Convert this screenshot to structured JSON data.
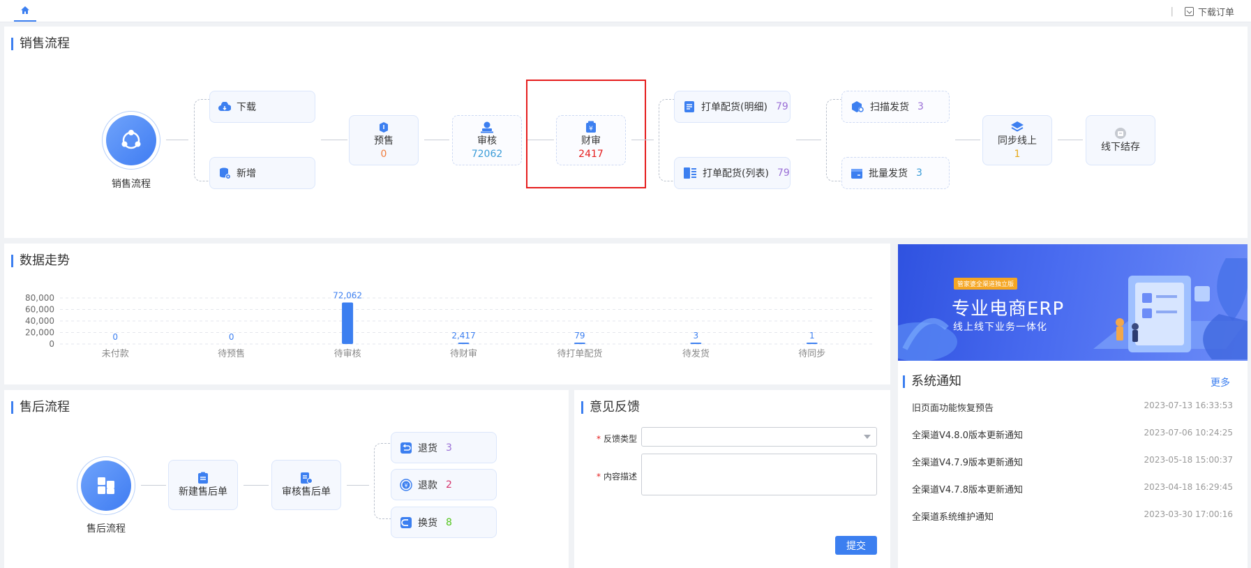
{
  "topbar": {
    "download_label": "下载订单",
    "sep": "|"
  },
  "sales": {
    "title": "销售流程",
    "start_label": "销售流程",
    "download": "下载",
    "add": "新增",
    "presale": {
      "label": "预售",
      "count": "0"
    },
    "audit": {
      "label": "审核",
      "count": "72062"
    },
    "finance": {
      "label": "财审",
      "count": "2417"
    },
    "print_detail": {
      "label": "打单配货(明细)",
      "count": "79"
    },
    "print_list": {
      "label": "打单配货(列表)",
      "count": "79"
    },
    "scan_ship": {
      "label": "扫描发货",
      "count": "3"
    },
    "batch_ship": {
      "label": "批量发货",
      "count": "3"
    },
    "sync": {
      "label": "同步线上",
      "count": "1"
    },
    "offline": {
      "label": "线下结存"
    }
  },
  "trend": {
    "title": "数据走势"
  },
  "chart_data": {
    "type": "bar",
    "categories": [
      "未付款",
      "待预售",
      "待审核",
      "待财审",
      "待打单配货",
      "待发货",
      "待同步"
    ],
    "values": [
      0,
      0,
      72062,
      2417,
      79,
      3,
      1
    ],
    "value_labels": [
      "0",
      "0",
      "72,062",
      "2,417",
      "79",
      "3",
      "1"
    ],
    "yticks": [
      "80,000",
      "60,000",
      "40,000",
      "20,000",
      "0"
    ],
    "ylim": [
      0,
      80000
    ],
    "grid": true,
    "bar_color": "#3c7ff0"
  },
  "banner": {
    "tag": "管家婆全渠道独立版",
    "title": "专业电商ERP",
    "subtitle": "线上线下业务一体化"
  },
  "notices": {
    "title": "系统通知",
    "more": "更多",
    "items": [
      {
        "title": "旧页面功能恢复预告",
        "time": "2023-07-13 16:33:53"
      },
      {
        "title": "全渠道V4.8.0版本更新通知",
        "time": "2023-07-06 10:24:25"
      },
      {
        "title": "全渠道V4.7.9版本更新通知",
        "time": "2023-05-18 15:00:37"
      },
      {
        "title": "全渠道V4.7.8版本更新通知",
        "time": "2023-04-18 16:29:45"
      },
      {
        "title": "全渠道系统维护通知",
        "time": "2023-03-30 17:00:16"
      }
    ]
  },
  "aftersale": {
    "title": "售后流程",
    "start_label": "售后流程",
    "new": "新建售后单",
    "audit": "审核售后单",
    "return": {
      "label": "退货",
      "count": "3"
    },
    "refund": {
      "label": "退款",
      "count": "2"
    },
    "exchange": {
      "label": "换货",
      "count": "8"
    }
  },
  "feedback": {
    "title": "意见反馈",
    "req": "*",
    "type_label": "反馈类型",
    "content_label": "内容描述",
    "submit": "提交"
  },
  "colors": {
    "accent": "#3c7ff0",
    "orange": "#f07c3c",
    "teal": "#3a9cd8",
    "red": "#e51c1c",
    "purple": "#9a6fd6",
    "green": "#52c41a",
    "gold": "#e6a817",
    "pink": "#d6336c"
  }
}
